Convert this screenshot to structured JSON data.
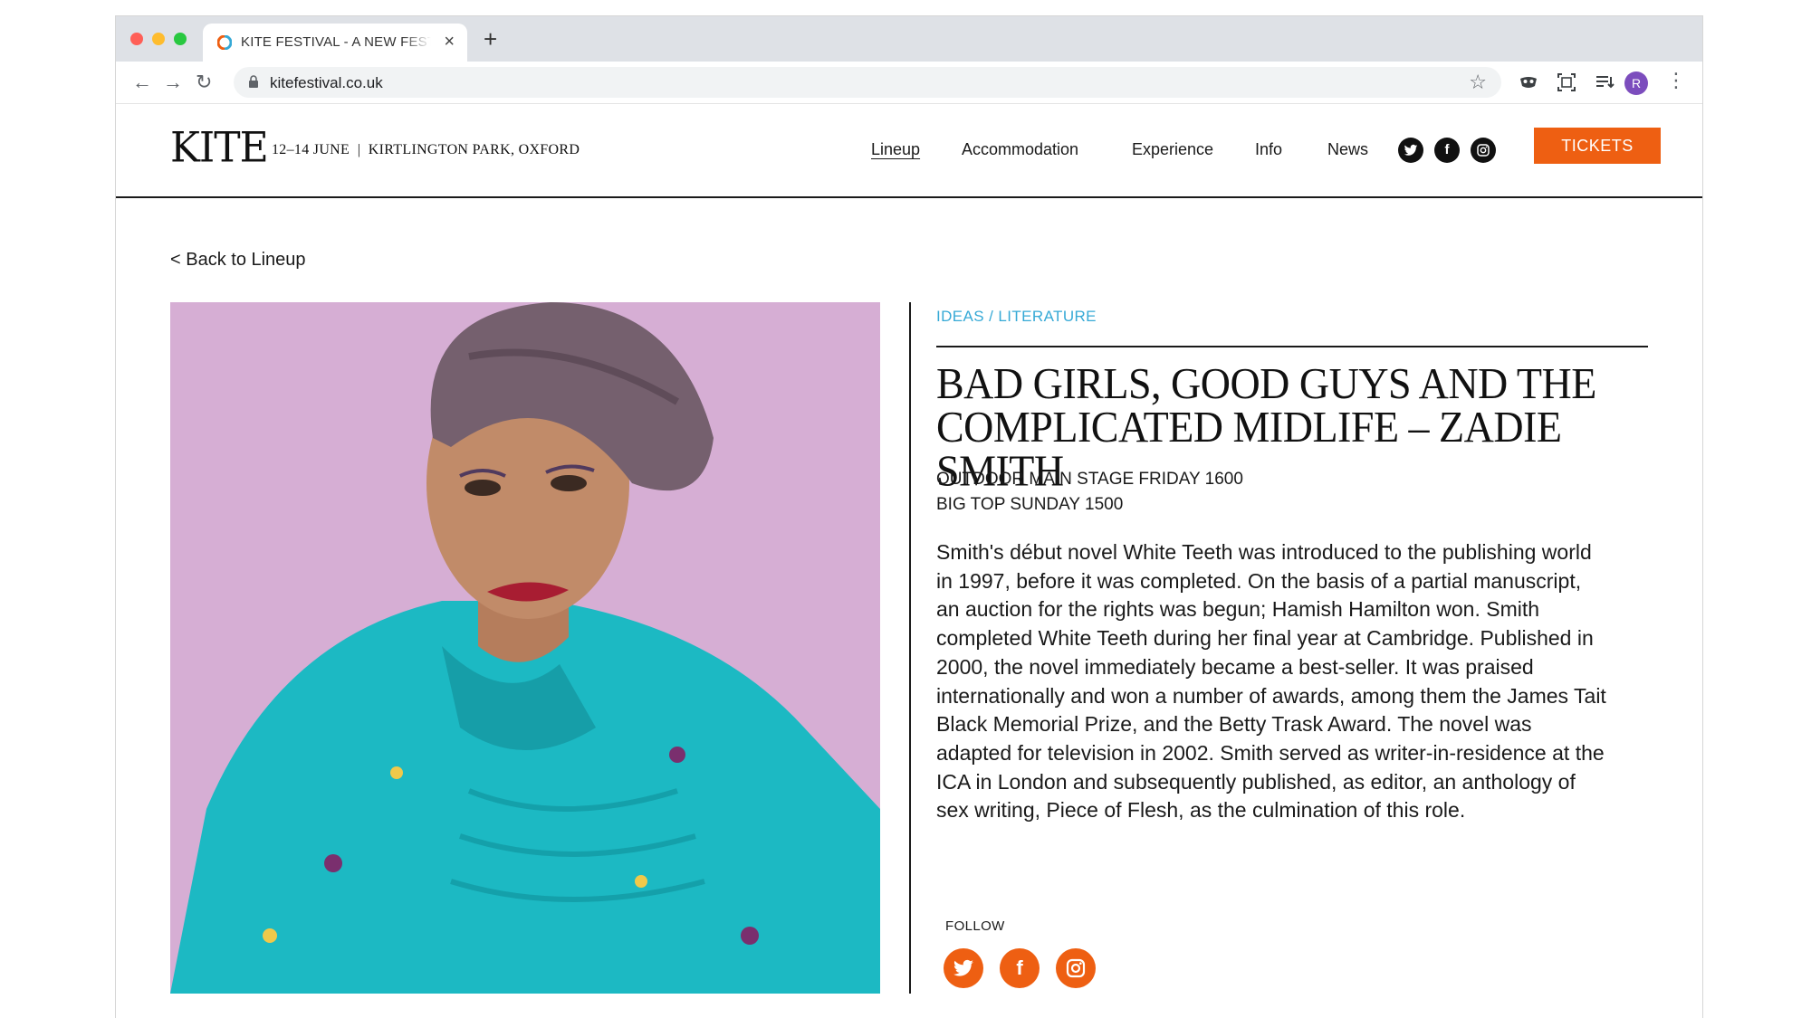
{
  "browser": {
    "tab_title": "KITE FESTIVAL - A NEW FESTIVAL",
    "tab_close": "×",
    "new_tab": "+",
    "url": "kitefestival.co.uk",
    "avatar_initial": "R",
    "back_glyph": "←",
    "forward_glyph": "→",
    "reload_glyph": "↻",
    "star_glyph": "☆",
    "menu_glyph": "⋮"
  },
  "site": {
    "logo": "KITE",
    "tagline": "12–14 JUNE  |  KIRTLINGTON PARK, OXFORD",
    "nav": [
      {
        "label": "Lineup",
        "active": true
      },
      {
        "label": "Accommodation",
        "active": false
      },
      {
        "label": "Experience",
        "active": false
      },
      {
        "label": "Info",
        "active": false
      },
      {
        "label": "News",
        "active": false
      }
    ],
    "header_social": [
      "twitter-icon",
      "facebook-icon",
      "instagram-icon"
    ],
    "tickets_label": "TICKETS",
    "accent_color": "#ee5f12",
    "category_color": "#36a9d6"
  },
  "event": {
    "back_label": "< Back to Lineup",
    "category": "IDEAS / LITERATURE",
    "title": "BAD GIRLS, GOOD GUYS AND THE COMPLICATED MIDLIFE – ZADIE SMITH",
    "performances": [
      "OUTDOOR MAIN STAGE FRIDAY 1600",
      "BIG TOP SUNDAY 1500"
    ],
    "description": "Smith's début novel White Teeth was introduced to the publishing world in 1997, before it was completed. On the basis of a partial manuscript, an auction for the rights was begun; Hamish Hamilton won. Smith completed White Teeth during her final year at Cambridge. Published in 2000, the novel immediately became a best-seller. It was praised internationally and won a number of awards, among them the James Tait Black Memorial Prize, and the Betty Trask Award. The novel was adapted for television in 2002. Smith served as writer-in-residence at the ICA in London and subsequently published, as editor, an anthology of sex writing, Piece of Flesh, as the culmination of this role.",
    "follow_label": "FOLLOW",
    "follow_social": [
      "twitter-icon",
      "facebook-icon",
      "instagram-icon"
    ]
  }
}
